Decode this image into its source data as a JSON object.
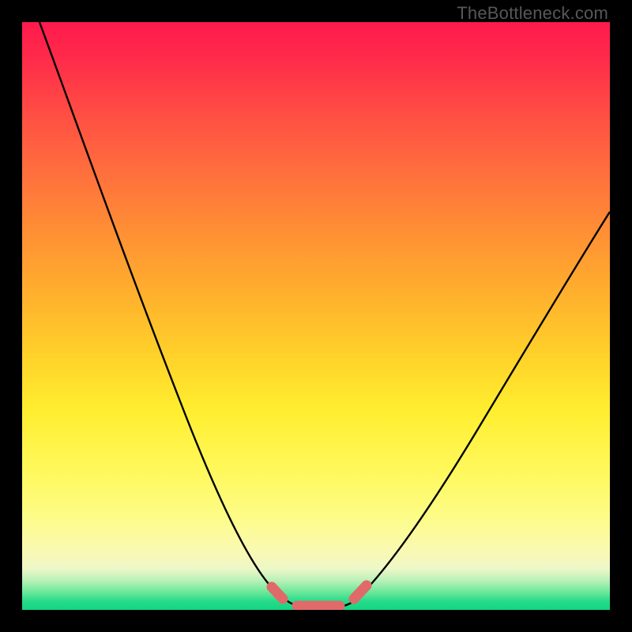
{
  "watermark": {
    "text": "TheBottleneck.com"
  },
  "chart_data": {
    "type": "line",
    "title": "",
    "xlabel": "",
    "ylabel": "",
    "xlim": [
      0,
      100
    ],
    "ylim": [
      0,
      100
    ],
    "series": [
      {
        "name": "bottleneck-curve",
        "x": [
          0,
          5,
          10,
          15,
          20,
          25,
          30,
          35,
          40,
          43,
          46,
          49,
          52,
          55,
          58,
          62,
          68,
          74,
          80,
          86,
          92,
          100
        ],
        "values": [
          100,
          88,
          76,
          64,
          52,
          41,
          30,
          20,
          11,
          5,
          2,
          0.5,
          0.5,
          1,
          3,
          7,
          14,
          22,
          30,
          38,
          46,
          56
        ]
      }
    ],
    "annotations": [
      {
        "type": "sausage-band",
        "x_range": [
          43,
          58
        ],
        "y": 0.5,
        "color": "#e06a6a"
      }
    ],
    "gradient_fill": {
      "direction": "vertical",
      "stops": [
        {
          "pos": 0.0,
          "color": "#ff1a4d"
        },
        {
          "pos": 0.5,
          "color": "#ffd22b"
        },
        {
          "pos": 0.85,
          "color": "#fdfca0"
        },
        {
          "pos": 1.0,
          "color": "#10d682"
        }
      ]
    }
  }
}
